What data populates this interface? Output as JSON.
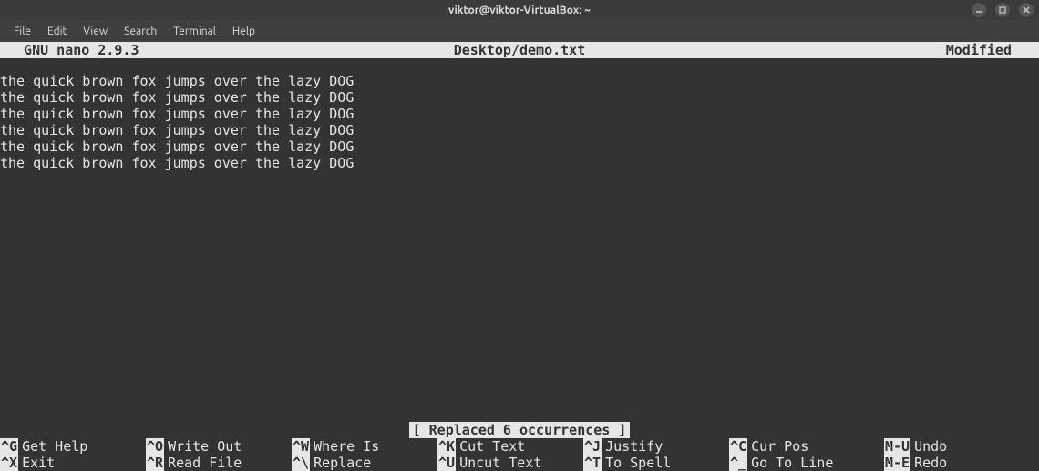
{
  "window": {
    "title": "viktor@viktor-VirtualBox: ~"
  },
  "menubar": {
    "items": [
      "File",
      "Edit",
      "View",
      "Search",
      "Terminal",
      "Help"
    ]
  },
  "nano": {
    "header_left": "  GNU nano 2.9.3",
    "header_center": "Desktop/demo.txt",
    "header_right": "Modified"
  },
  "content_lines": [
    "the quick brown fox jumps over the lazy DOG",
    "the quick brown fox jumps over the lazy DOG",
    "the quick brown fox jumps over the lazy DOG",
    "the quick brown fox jumps over the lazy DOG",
    "the quick brown fox jumps over the lazy DOG",
    "the quick brown fox jumps over the lazy DOG"
  ],
  "status_message": "[ Replaced 6 occurrences ]",
  "shortcuts": {
    "row1": [
      {
        "key": "^G",
        "label": "Get Help"
      },
      {
        "key": "^O",
        "label": "Write Out"
      },
      {
        "key": "^W",
        "label": "Where Is"
      },
      {
        "key": "^K",
        "label": "Cut Text"
      },
      {
        "key": "^J",
        "label": "Justify"
      },
      {
        "key": "^C",
        "label": "Cur Pos"
      },
      {
        "key": "M-U",
        "label": "Undo"
      }
    ],
    "row2": [
      {
        "key": "^X",
        "label": "Exit"
      },
      {
        "key": "^R",
        "label": "Read File"
      },
      {
        "key": "^\\",
        "label": "Replace"
      },
      {
        "key": "^U",
        "label": "Uncut Text"
      },
      {
        "key": "^T",
        "label": "To Spell"
      },
      {
        "key": "^_",
        "label": "Go To Line"
      },
      {
        "key": "M-E",
        "label": "Redo"
      }
    ]
  }
}
